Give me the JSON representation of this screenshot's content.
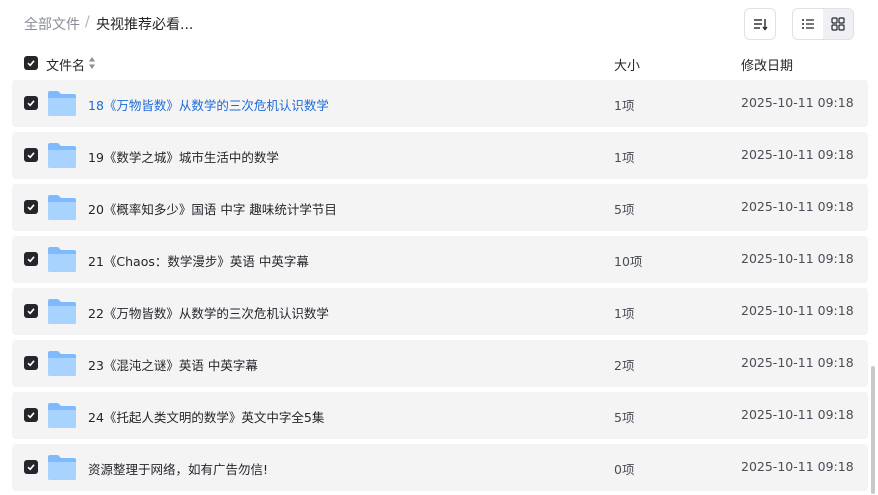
{
  "breadcrumb": {
    "root": "全部文件",
    "separator": "/",
    "current": "央视推荐必看..."
  },
  "toolbar": {
    "sort_icon": "sort-icon",
    "list_icon": "list-view-icon",
    "grid_icon": "grid-view-icon"
  },
  "columns": {
    "name": "文件名",
    "size": "大小",
    "modified": "修改日期"
  },
  "colors": {
    "accent": "#1e6bd6",
    "row_bg": "#f4f4f5",
    "checkbox": "#25262b",
    "folder": "#8ec5ff"
  },
  "rows": [
    {
      "name": "18《万物皆数》从数学的三次危机认识数学",
      "size": "1项",
      "date": "2025-10-11 09:18",
      "checked": true,
      "highlighted": true
    },
    {
      "name": "19《数学之城》城市生活中的数学",
      "size": "1项",
      "date": "2025-10-11 09:18",
      "checked": true
    },
    {
      "name": "20《概率知多少》国语 中字 趣味统计学节目",
      "size": "5项",
      "date": "2025-10-11 09:18",
      "checked": true
    },
    {
      "name": "21《Chaos：数学漫步》英语 中英字幕",
      "size": "10项",
      "date": "2025-10-11 09:18",
      "checked": true
    },
    {
      "name": "22《万物皆数》从数学的三次危机认识数学",
      "size": "1项",
      "date": "2025-10-11 09:18",
      "checked": true
    },
    {
      "name": "23《混沌之谜》英语 中英字幕",
      "size": "2项",
      "date": "2025-10-11 09:18",
      "checked": true
    },
    {
      "name": "24《托起人类文明的数学》英文中字全5集",
      "size": "5项",
      "date": "2025-10-11 09:18",
      "checked": true
    },
    {
      "name": "资源整理于网络，如有广告勿信!",
      "size": "0项",
      "date": "2025-10-11 09:18",
      "checked": true
    }
  ]
}
